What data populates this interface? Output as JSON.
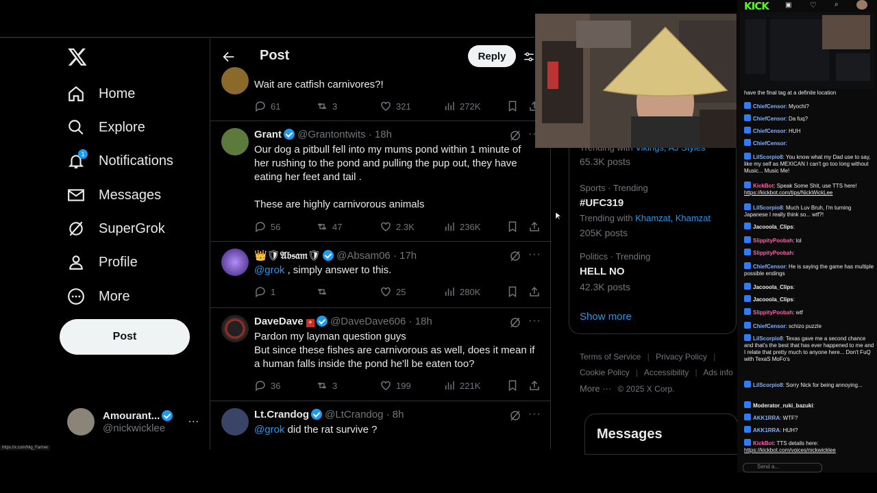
{
  "nav": {
    "items": [
      {
        "label": "Home",
        "icon": "home-icon"
      },
      {
        "label": "Explore",
        "icon": "search-icon"
      },
      {
        "label": "Notifications",
        "icon": "bell-icon",
        "badge": "1"
      },
      {
        "label": "Messages",
        "icon": "mail-icon"
      },
      {
        "label": "SuperGrok",
        "icon": "grok-icon"
      },
      {
        "label": "Profile",
        "icon": "person-icon"
      },
      {
        "label": "More",
        "icon": "more-circle-icon"
      }
    ],
    "post_label": "Post",
    "account": {
      "name": "Amourant...",
      "handle": "@nickwicklee"
    }
  },
  "status_url": "https://x.com/Nig_Farmer",
  "header": {
    "title": "Post",
    "reply_label": "Reply"
  },
  "tweets": [
    {
      "name": "",
      "handle": "",
      "time": "",
      "text": "Wait are catfish carnivores?!",
      "replies": "61",
      "reposts": "3",
      "likes": "321",
      "views": "272K"
    },
    {
      "name": "Grant",
      "handle": "@Grantontwits",
      "time": "· 18h",
      "text": "Our dog a pitbull fell into my mums pond within 1 minute of her rushing to the pond and pulling the pup out, they have eating her feet and tail .",
      "text2": "These are highly carnivorous animals",
      "replies": "56",
      "reposts": "47",
      "likes": "2.3K",
      "views": "236K"
    },
    {
      "name": "𝔄𝔟𝔰𝔞𝔪",
      "handle": "@Absam06",
      "time": "· 17h",
      "mention": "@grok",
      "text": " , simply answer to this.",
      "replies": "1",
      "reposts": "",
      "likes": "25",
      "views": "280K"
    },
    {
      "name": "DaveDave",
      "handle": "@DaveDave606",
      "time": "· 18h",
      "text": "Pardon my layman question guys",
      "text2": "But since these fishes are carnivorous as well, does it mean if a human falls inside the pond he'll be eaten too?",
      "replies": "36",
      "reposts": "3",
      "likes": "199",
      "views": "221K"
    },
    {
      "name": "Lt.Crandog",
      "handle": "@LtCrandog",
      "time": "· 8h",
      "mention": "@grok",
      "text": " did the rat survive ?"
    }
  ],
  "trends": {
    "t1": {
      "context": "Trending with",
      "with": "Vikings, AJ Styles",
      "posts": "65.3K posts"
    },
    "t2": {
      "label": "Sports · Trending",
      "title": "#UFC319",
      "context": "Trending with",
      "with": "Khamzat, Khamzat",
      "posts": "205K posts"
    },
    "t3": {
      "label": "Politics · Trending",
      "title": "HELL NO",
      "posts": "42.3K posts"
    },
    "show_more": "Show more"
  },
  "footer": {
    "links": [
      "Terms of Service",
      "Privacy Policy",
      "Cookie Policy",
      "Accessibility",
      "Ads info"
    ],
    "more": "More ···",
    "copyright": "© 2025 X Corp."
  },
  "messages_dock": "Messages",
  "chat": {
    "brand": "KICK",
    "lines": [
      {
        "user": "",
        "msg": "have the final tag at a definite location"
      },
      {
        "user": "ChiefCensor",
        "msg": ": Myochi?"
      },
      {
        "user": "ChiefCensor",
        "msg": ": Da fuq?"
      },
      {
        "user": "ChiefCensor",
        "msg": ": HUH"
      },
      {
        "user": "ChiefCensor",
        "msg": ":"
      },
      {
        "user": "LilScorpio8",
        "msg": ": You know what my Dad use to say, like my self as MEXICAN I can't go too long without Music... Music Me!"
      },
      {
        "user": "KickBot",
        "msg": ": Speak Some Shit, use TTS here! ",
        "link": "https://kickbot.com/tips/NickWickLee"
      },
      {
        "user": "LilScorpio8",
        "msg": ": Much Luv Bruh, I'm turning Japanese I really think so... wtf?!"
      },
      {
        "user": "Jacooola_Clips",
        "msg": ":"
      },
      {
        "user": "SlippityPoobah",
        "msg": ": lol"
      },
      {
        "user": "SlippityPoobah",
        "msg": ":"
      },
      {
        "user": "ChiefCensor",
        "msg": ": He is saying the game has multiple possible endings"
      },
      {
        "user": "Jacooola_Clips",
        "msg": ":"
      },
      {
        "user": "Jacooola_Clips",
        "msg": ":"
      },
      {
        "user": "SlippityPoobah",
        "msg": ": wtf"
      },
      {
        "user": "ChiefCensor",
        "msg": ": schizo puzzle"
      },
      {
        "user": "LilScorpio8",
        "msg": ": Texas gave me a second chance and that's the best that has ever happened to me and I relate that pretty much to anyone here... Don't FuQ with TexaS MoFo's"
      },
      {
        "user": "LilScorpio8",
        "msg": ": Sorry Nick for being annoying..."
      },
      {
        "user": "Moderator_ruki_bazuki",
        "msg": ":"
      },
      {
        "user": "AKK1RRA",
        "msg": ": WTF?"
      },
      {
        "user": "AKK1RRA",
        "msg": ": HUH?"
      },
      {
        "user": "KickBot",
        "msg": ": TTS details here: ",
        "link": "https://kickbot.com/voices/nickwicklee"
      }
    ],
    "send_placeholder": "Send a..."
  },
  "colors": {
    "accent": "#1d9bf0",
    "kick_green": "#53fc18",
    "bg": "#000000"
  }
}
